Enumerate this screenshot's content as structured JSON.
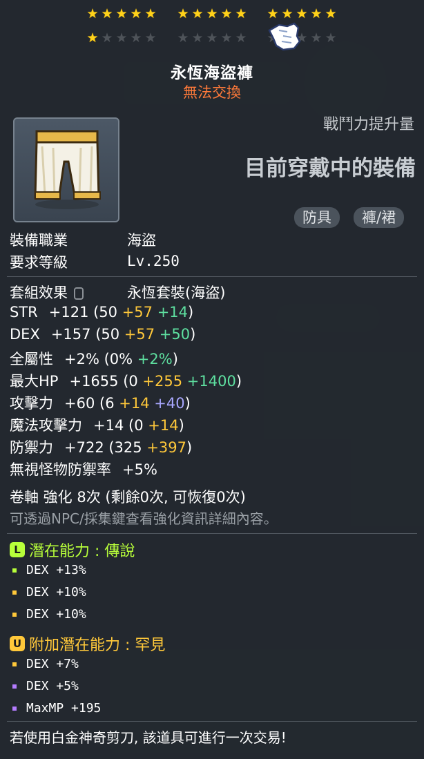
{
  "item": {
    "name": "永恆海盜褲",
    "trade_status": "無法交換",
    "stars_filled": 16,
    "stars_total": 25
  },
  "header": {
    "power_label": "戰鬥力提升量",
    "equipped_label": "目前穿戴中的裝備"
  },
  "tags": [
    "防具",
    "褲/裙"
  ],
  "requirements": {
    "job_label": "裝備職業",
    "job_value": "海盜",
    "level_label": "要求等級",
    "level_value": "Lv.250"
  },
  "set": {
    "label": "套組效果",
    "value": "永恆套裝(海盜)"
  },
  "stats": [
    {
      "name": "STR",
      "total": "+121",
      "open": " (50 ",
      "a": "+57",
      "b": " +14",
      "close": ")"
    },
    {
      "name": "DEX",
      "total": "+157",
      "open": " (50 ",
      "a": "+57",
      "b": " +50",
      "close": ")"
    },
    {
      "name": "全屬性",
      "total": "+2%",
      "open": " (0% ",
      "a": "",
      "b": "+2%",
      "close": ")"
    },
    {
      "name": "最大HP",
      "total": "+1655",
      "open": " (0 ",
      "a": "+255",
      "b": " +1400",
      "close": ")"
    },
    {
      "name": "攻擊力",
      "total": "+60",
      "open": " (6 ",
      "a": "+14",
      "b": " +40",
      "close": ")"
    },
    {
      "name": "魔法攻擊力",
      "total": "+14",
      "open": " (0 ",
      "a": "+14",
      "b": "",
      "close": ")"
    },
    {
      "name": "防禦力",
      "total": "+722",
      "open": " (325 ",
      "a": "+397",
      "b": "",
      "close": ")"
    },
    {
      "name": "無視怪物防禦率",
      "total": "+5%",
      "open": "",
      "a": "",
      "b": "",
      "close": ""
    }
  ],
  "scroll": {
    "line": "卷軸 強化 8次 (剩餘0次, 可恢復0次)",
    "note": "可透過NPC/採集鍵查看強化資訊詳細內容。"
  },
  "potential": {
    "title": "潛在能力 : 傳說",
    "icon_letter": "L",
    "lines": [
      "DEX +13%",
      "DEX +10%",
      "DEX +10%"
    ]
  },
  "additional": {
    "title": "附加潛在能力 : 罕見",
    "icon_letter": "U",
    "lines": [
      "DEX +7%",
      "DEX +5%",
      "MaxMP +195"
    ]
  },
  "footer": "若使用白金神奇剪刀, 該道具可進行一次交易!",
  "colors": {
    "star_on": "#ffd21a",
    "trade": "#ff7a3a",
    "legendary": "#b8ff3a",
    "unique": "#ffc83a",
    "lav": "#a9a8ff"
  }
}
